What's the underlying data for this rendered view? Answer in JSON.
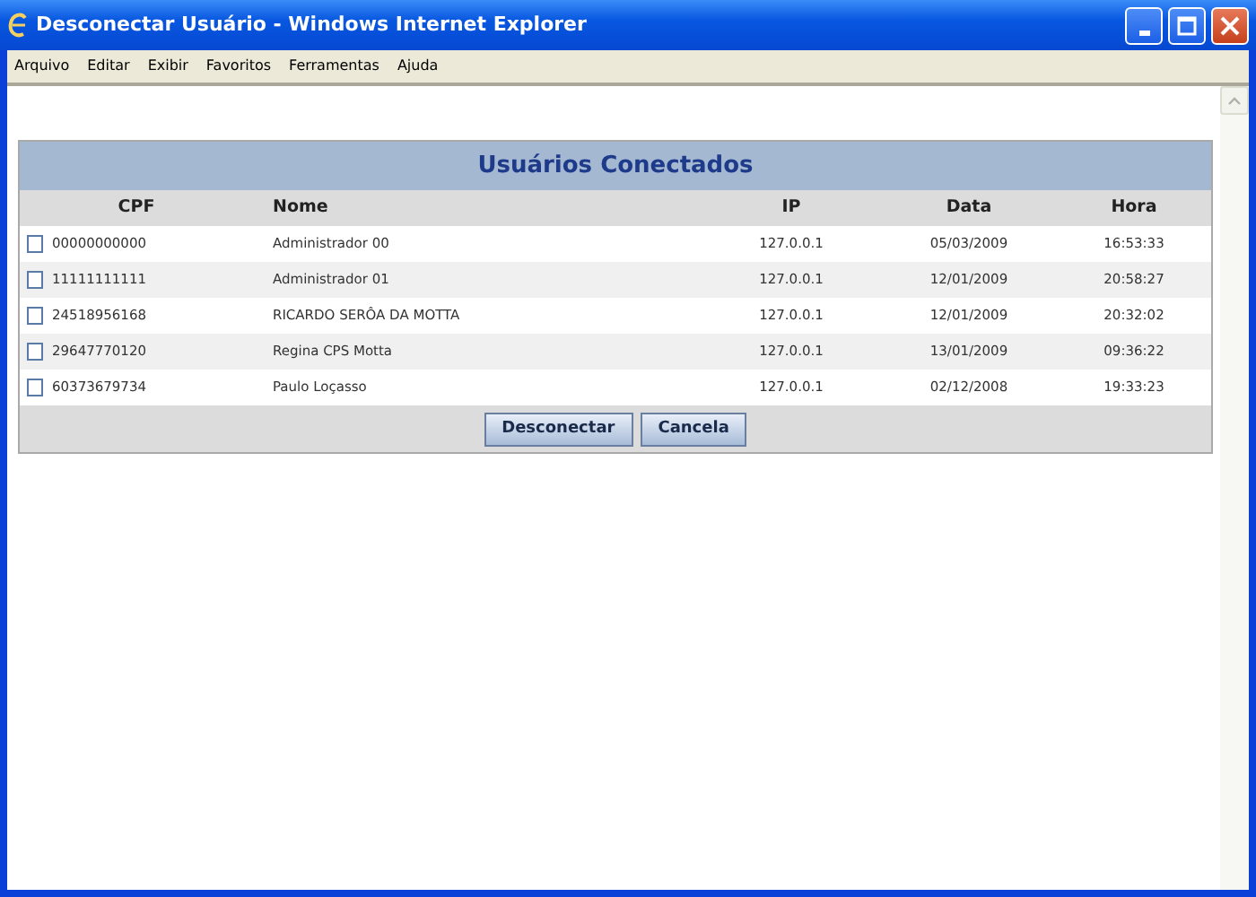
{
  "window": {
    "title": "Desconectar Usuário - Windows Internet Explorer"
  },
  "menu": [
    "Arquivo",
    "Editar",
    "Exibir",
    "Favoritos",
    "Ferramentas",
    "Ajuda"
  ],
  "panel": {
    "title": "Usuários Conectados",
    "columns": [
      "CPF",
      "Nome",
      "IP",
      "Data",
      "Hora"
    ],
    "rows": [
      {
        "checked": false,
        "cpf": "00000000000",
        "nome": "Administrador 00",
        "ip": "127.0.0.1",
        "data": "05/03/2009",
        "hora": "16:53:33"
      },
      {
        "checked": false,
        "cpf": "11111111111",
        "nome": "Administrador 01",
        "ip": "127.0.0.1",
        "data": "12/01/2009",
        "hora": "20:58:27"
      },
      {
        "checked": false,
        "cpf": "24518956168",
        "nome": "RICARDO SERÔA DA MOTTA",
        "ip": "127.0.0.1",
        "data": "12/01/2009",
        "hora": "20:32:02"
      },
      {
        "checked": false,
        "cpf": "29647770120",
        "nome": "Regina CPS Motta",
        "ip": "127.0.0.1",
        "data": "13/01/2009",
        "hora": "09:36:22"
      },
      {
        "checked": false,
        "cpf": "60373679734",
        "nome": "Paulo Loçasso",
        "ip": "127.0.0.1",
        "data": "02/12/2008",
        "hora": "19:33:23"
      }
    ],
    "buttons": [
      "Desconectar",
      "Cancela"
    ]
  }
}
